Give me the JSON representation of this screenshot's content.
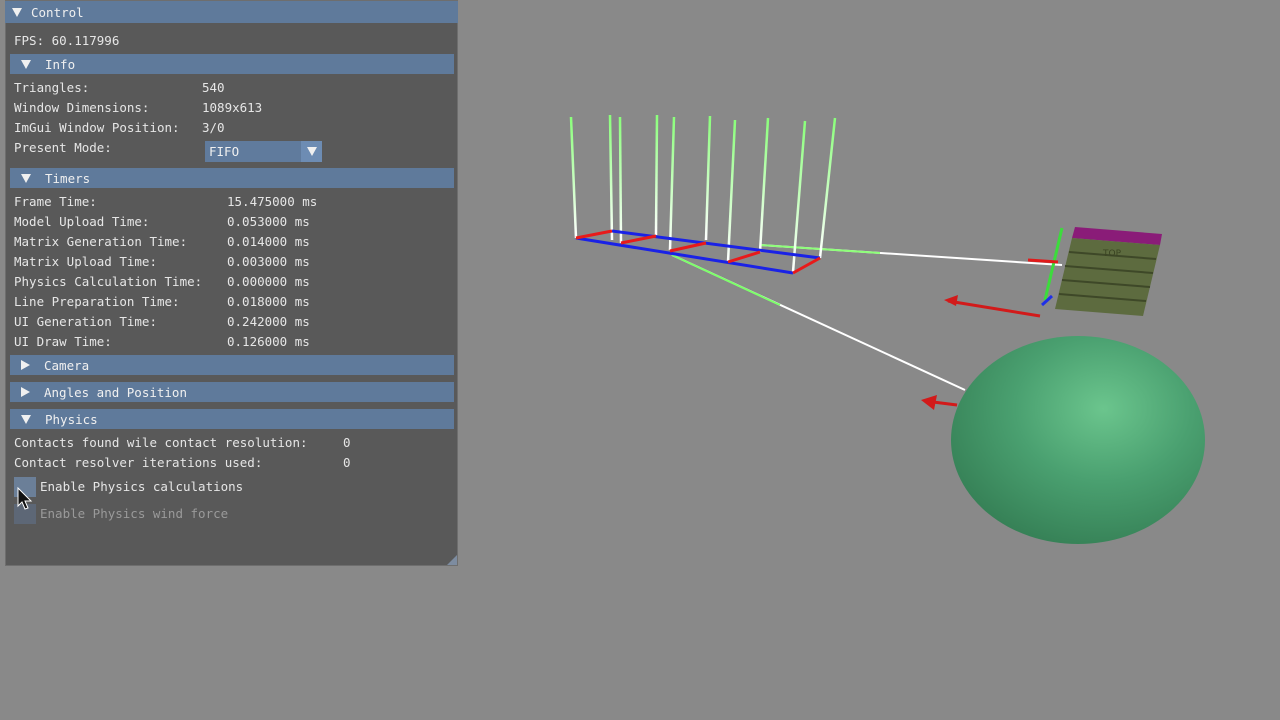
{
  "window": {
    "title": "Control"
  },
  "fps": "FPS: 60.117996",
  "info": {
    "header": "Info",
    "rows": [
      {
        "label": "Triangles:",
        "value": "540"
      },
      {
        "label": "Window Dimensions:",
        "value": "1089x613"
      },
      {
        "label": "ImGui Window Position:",
        "value": "3/0"
      }
    ],
    "present_mode": {
      "label": "Present Mode:",
      "value": "FIFO"
    }
  },
  "timers": {
    "header": "Timers",
    "rows": [
      {
        "label": "Frame Time:",
        "value": "15.475000 ms"
      },
      {
        "label": "Model Upload Time:",
        "value": "0.053000 ms"
      },
      {
        "label": "Matrix Generation Time:",
        "value": "0.014000 ms"
      },
      {
        "label": "Matrix Upload Time:",
        "value": "0.003000 ms"
      },
      {
        "label": "Physics Calculation Time:",
        "value": "0.000000 ms"
      },
      {
        "label": "Line Preparation Time:",
        "value": "0.018000 ms"
      },
      {
        "label": "UI Generation Time:",
        "value": "0.242000 ms"
      },
      {
        "label": "UI Draw Time:",
        "value": "0.126000 ms"
      }
    ]
  },
  "camera": {
    "header": "Camera"
  },
  "angles": {
    "header": "Angles and Position"
  },
  "physics": {
    "header": "Physics",
    "contacts_label": "Contacts found wile contact resolution:",
    "contacts_value": "0",
    "iterations_label": "Contact resolver iterations used:",
    "iterations_value": "0",
    "enable_calc": {
      "label": "Enable Physics calculations",
      "checked": false
    },
    "enable_wind": {
      "label": "Enable Physics wind force",
      "checked": false,
      "disabled": true
    }
  },
  "crate_text": "TOP",
  "colors": {
    "background": "#898989",
    "panel": "#595959",
    "header": "#5f7a9b",
    "sphere": "#3f8f62",
    "crate": "#5b6a3a",
    "crate_top": "#7a1f6e"
  },
  "icons": {
    "collapse": "triangle-down-icon",
    "expand": "triangle-right-icon",
    "cursor": "mouse-pointer-icon"
  }
}
